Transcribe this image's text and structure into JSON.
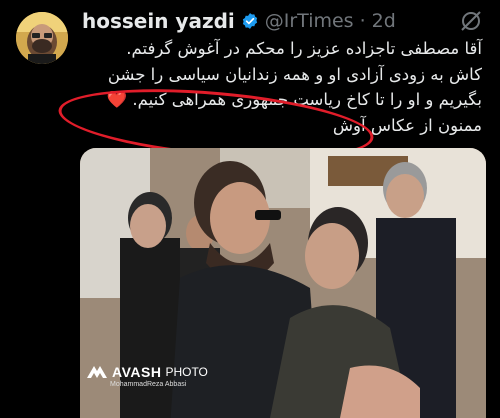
{
  "tweet": {
    "author_name": "hossein yazdi",
    "author_handle": "@IrTimes",
    "separator": "·",
    "time": "2d",
    "text_lines": [
      "آقا مصطفی تاجزاده عزیز را محکم در آغوش گرفتم.",
      "کاش به زودی آزادی او و همه زندانیان سیاسی را جشن",
      "بگیریم و او را تا کاخ ریاست جمهوری همراهی کنیم. ❤️",
      "ممنون از عکاس آوش"
    ]
  },
  "media": {
    "watermark_logo": "AVASH",
    "watermark_photo": "PHOTO",
    "watermark_credit": "MohammadReza Abbasi"
  },
  "colors": {
    "background": "#000000",
    "text": "#e7e9ea",
    "muted": "#71767b",
    "verified": "#1d9bf0",
    "annotation": "#e11d2a"
  },
  "icons": [
    "avatar",
    "verified-badge-icon",
    "mute-icon"
  ]
}
